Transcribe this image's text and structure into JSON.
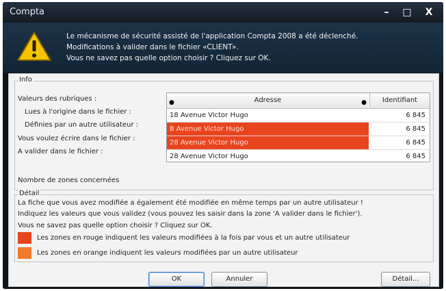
{
  "window": {
    "title": "Compta",
    "controls": {
      "minimize": "–",
      "maximize": "□",
      "close": "X"
    }
  },
  "message": {
    "lines": [
      "Le mécanisme de sécurité assisté de l'application Compta 2008 a été déclenché.",
      "Modifications à valider dans le fichier «CLIENT».",
      "Vous ne savez pas quelle option choisir ? Cliquez sur OK."
    ],
    "icon": "warning-icon"
  },
  "info": {
    "label": "Info",
    "values_label": "Valeurs des rubriques :",
    "row_labels": [
      "Lues à l'origine dans le fichier :",
      "Définies par un autre utilisateur :",
      "Vous voulez écrire dans le fichier :",
      "A valider dans le fichier :"
    ],
    "zones_label": "Nombre de zones concernées",
    "table": {
      "headers": {
        "address": "Adresse",
        "id": "Identifiant"
      },
      "rows": [
        {
          "address": "18 Avenue Victor Hugo",
          "id": "6 845",
          "highlight": "none"
        },
        {
          "address": "8 Avenue Victor Hugo",
          "id": "6 845",
          "highlight": "red"
        },
        {
          "address": "28 Avenue Victor Hugo",
          "id": "6 845",
          "highlight": "red"
        },
        {
          "address": "28 Avenue Victor Hugo",
          "id": "6 845",
          "highlight": "none"
        }
      ]
    }
  },
  "detail": {
    "label": "Détail",
    "lines": [
      "La fiche que vous avez modifiée a également été modifiée en même temps par un autre utilisateur !",
      "Indiquez les valeurs que vous validez (vous pouvez les saisir dans la zone 'A valider dans le fichier').",
      "Vous ne savez pas quelle option choisir ? Cliquez sur OK."
    ],
    "legend": [
      {
        "color": "#e8441e",
        "text": "Les zones en rouge indiquent les valeurs modifiées à la fois par vous et un autre utilisateur"
      },
      {
        "color": "#f07a2a",
        "text": "Les zones en orange indiquent les valeurs modifiées par un autre utilisateur"
      }
    ]
  },
  "buttons": {
    "ok": "OK",
    "cancel": "Annuler",
    "detail": "Détail..."
  },
  "colors": {
    "red_zone": "#e8441e",
    "orange_zone": "#f07a2a",
    "titlebar": "#1b2430"
  }
}
